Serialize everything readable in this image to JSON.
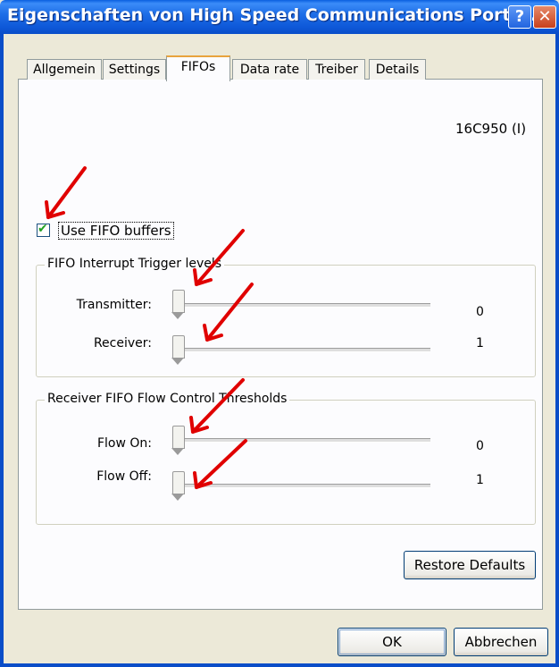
{
  "window": {
    "title": "Eigenschaften von High Speed Communications Port (...",
    "help_glyph": "?",
    "close_glyph": "✕"
  },
  "tabs": [
    {
      "label": "Allgemein"
    },
    {
      "label": "Settings"
    },
    {
      "label": "FIFOs",
      "active": true
    },
    {
      "label": "Data rate"
    },
    {
      "label": "Treiber"
    },
    {
      "label": "Details"
    }
  ],
  "uart_type": "16C950 (I)",
  "use_fifo": {
    "label": "Use FIFO buffers",
    "checked": true,
    "mark": "✔"
  },
  "interrupt_group": {
    "title": "FIFO Interrupt Trigger levels",
    "rows": [
      {
        "label": "Transmitter:",
        "value": "0"
      },
      {
        "label": "Receiver:",
        "value": "1"
      }
    ]
  },
  "flow_group": {
    "title": "Receiver FIFO Flow Control Thresholds",
    "rows": [
      {
        "label": "Flow On:",
        "value": "0"
      },
      {
        "label": "Flow Off:",
        "value": "1"
      }
    ]
  },
  "buttons": {
    "restore_defaults": "Restore Defaults",
    "ok": "OK",
    "cancel": "Abbrechen"
  },
  "annotation_color": "#e00000"
}
